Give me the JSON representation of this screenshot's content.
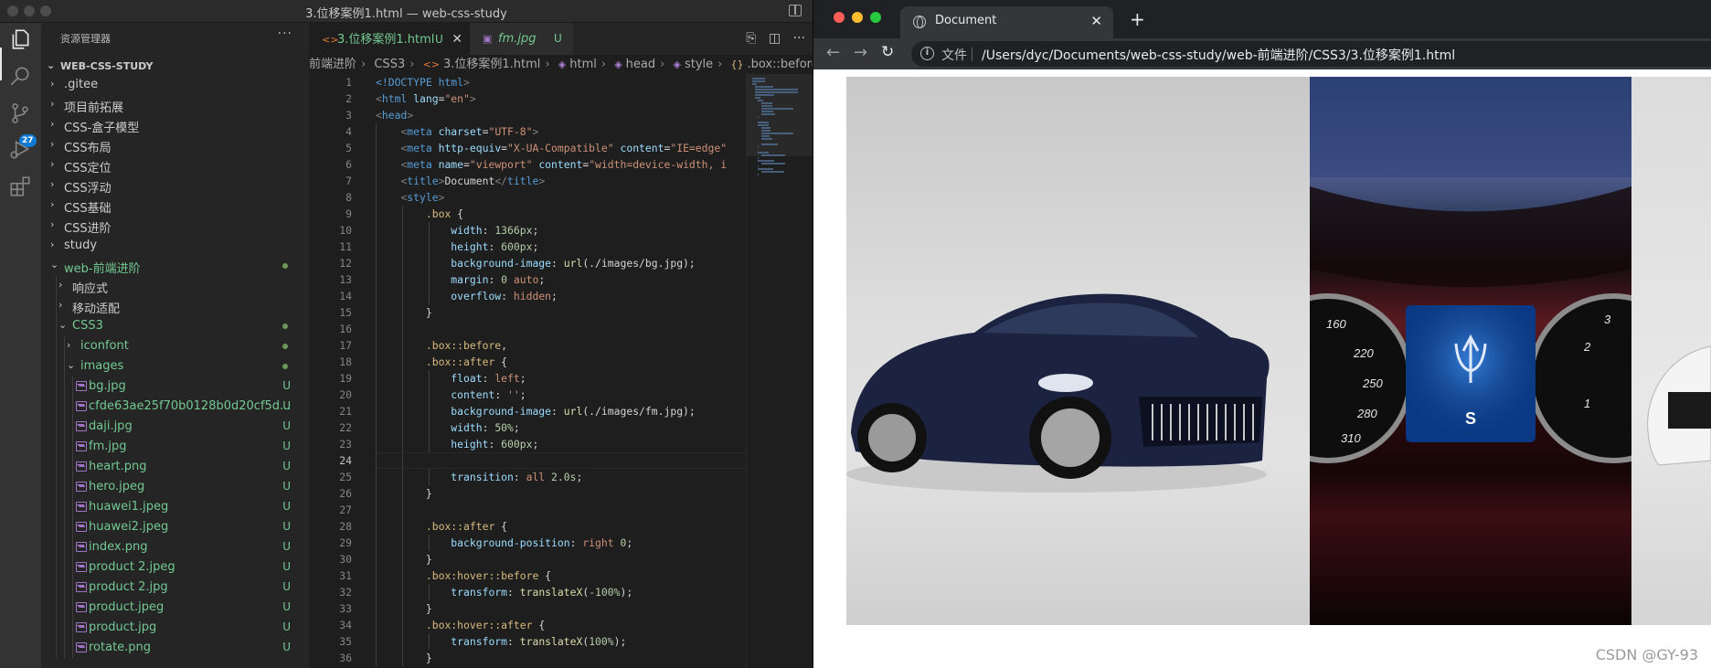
{
  "vscode": {
    "window_title": "3.位移案例1.html — web-css-study",
    "explorer_header": "资源管理器",
    "more_label": "···",
    "folder_name": "WEB-CSS-STUDY",
    "scm_badge": "27",
    "tree": [
      {
        "label": ".gitee",
        "depth": 0,
        "type": "folder",
        "open": false
      },
      {
        "label": "项目前拓展",
        "depth": 0,
        "type": "folder",
        "open": false
      },
      {
        "label": "CSS-盒子模型",
        "depth": 0,
        "type": "folder",
        "open": false
      },
      {
        "label": "CSS布局",
        "depth": 0,
        "type": "folder",
        "open": false
      },
      {
        "label": "CSS定位",
        "depth": 0,
        "type": "folder",
        "open": false
      },
      {
        "label": "CSS浮动",
        "depth": 0,
        "type": "folder",
        "open": false
      },
      {
        "label": "CSS基础",
        "depth": 0,
        "type": "folder",
        "open": false
      },
      {
        "label": "CSS进阶",
        "depth": 0,
        "type": "folder",
        "open": false
      },
      {
        "label": "study",
        "depth": 0,
        "type": "folder",
        "open": false
      },
      {
        "label": "web-前端进阶",
        "depth": 0,
        "type": "folder",
        "open": true,
        "green": true,
        "dot": true
      },
      {
        "label": "响应式",
        "depth": 1,
        "type": "folder",
        "open": false
      },
      {
        "label": "移动适配",
        "depth": 1,
        "type": "folder",
        "open": false
      },
      {
        "label": "CSS3",
        "depth": 1,
        "type": "folder",
        "open": true,
        "green": true,
        "dot": true
      },
      {
        "label": "iconfont",
        "depth": 2,
        "type": "folder",
        "open": false,
        "green": true,
        "dot": true
      },
      {
        "label": "images",
        "depth": 2,
        "type": "folder",
        "open": true,
        "green": true,
        "dot": true
      },
      {
        "label": "bg.jpg",
        "depth": 3,
        "type": "image",
        "green": true,
        "mark": "U"
      },
      {
        "label": "cfde63ae25f70b0128b0d20cf5d...",
        "depth": 3,
        "type": "image",
        "green": true,
        "mark": "U"
      },
      {
        "label": "daji.jpg",
        "depth": 3,
        "type": "image",
        "green": true,
        "mark": "U"
      },
      {
        "label": "fm.jpg",
        "depth": 3,
        "type": "image",
        "green": true,
        "mark": "U"
      },
      {
        "label": "heart.png",
        "depth": 3,
        "type": "image",
        "green": true,
        "mark": "U"
      },
      {
        "label": "hero.jpeg",
        "depth": 3,
        "type": "image",
        "green": true,
        "mark": "U"
      },
      {
        "label": "huawei1.jpeg",
        "depth": 3,
        "type": "image",
        "green": true,
        "mark": "U"
      },
      {
        "label": "huawei2.jpeg",
        "depth": 3,
        "type": "image",
        "green": true,
        "mark": "U"
      },
      {
        "label": "index.png",
        "depth": 3,
        "type": "image",
        "green": true,
        "mark": "U"
      },
      {
        "label": "product 2.jpeg",
        "depth": 3,
        "type": "image",
        "green": true,
        "mark": "U"
      },
      {
        "label": "product 2.jpg",
        "depth": 3,
        "type": "image",
        "green": true,
        "mark": "U"
      },
      {
        "label": "product.jpeg",
        "depth": 3,
        "type": "image",
        "green": true,
        "mark": "U"
      },
      {
        "label": "product.jpg",
        "depth": 3,
        "type": "image",
        "green": true,
        "mark": "U"
      },
      {
        "label": "rotate.png",
        "depth": 3,
        "type": "image",
        "green": true,
        "mark": "U"
      }
    ],
    "tabs": [
      {
        "name": "3.位移案例1.html",
        "mark": "U",
        "icon": "html-icon"
      },
      {
        "name": "fm.jpg",
        "mark": "U",
        "icon": "image-icon"
      }
    ],
    "breadcrumb": [
      "前端进阶",
      "CSS3",
      "3.位移案例1.html",
      "html",
      "head",
      "style",
      ".box::before"
    ],
    "current_line": 24,
    "code_lines": [
      [
        [
          "doc",
          "<!DOCTYPE "
        ],
        [
          "tag",
          "html"
        ],
        [
          "ang",
          ">"
        ]
      ],
      [
        [
          "ang",
          "<"
        ],
        [
          "tag",
          "html "
        ],
        [
          "attr",
          "lang"
        ],
        [
          "txt",
          "="
        ],
        [
          "str",
          "\"en\""
        ],
        [
          "ang",
          ">"
        ]
      ],
      [
        [
          "ang",
          "<"
        ],
        [
          "tag",
          "head"
        ],
        [
          "ang",
          ">"
        ]
      ],
      [
        [
          "txt",
          "    "
        ],
        [
          "ang",
          "<"
        ],
        [
          "tag",
          "meta "
        ],
        [
          "attr",
          "charset"
        ],
        [
          "txt",
          "="
        ],
        [
          "str",
          "\"UTF-8\""
        ],
        [
          "ang",
          ">"
        ]
      ],
      [
        [
          "txt",
          "    "
        ],
        [
          "ang",
          "<"
        ],
        [
          "tag",
          "meta "
        ],
        [
          "attr",
          "http-equiv"
        ],
        [
          "txt",
          "="
        ],
        [
          "str",
          "\"X-UA-Compatible\" "
        ],
        [
          "attr",
          "content"
        ],
        [
          "txt",
          "="
        ],
        [
          "str",
          "\"IE=edge\""
        ]
      ],
      [
        [
          "txt",
          "    "
        ],
        [
          "ang",
          "<"
        ],
        [
          "tag",
          "meta "
        ],
        [
          "attr",
          "name"
        ],
        [
          "txt",
          "="
        ],
        [
          "str",
          "\"viewport\" "
        ],
        [
          "attr",
          "content"
        ],
        [
          "txt",
          "="
        ],
        [
          "str",
          "\"width=device-width, i"
        ]
      ],
      [
        [
          "txt",
          "    "
        ],
        [
          "ang",
          "<"
        ],
        [
          "tag",
          "title"
        ],
        [
          "ang",
          ">"
        ],
        [
          "txt",
          "Document"
        ],
        [
          "ang",
          "</"
        ],
        [
          "tag",
          "title"
        ],
        [
          "ang",
          ">"
        ]
      ],
      [
        [
          "txt",
          "    "
        ],
        [
          "ang",
          "<"
        ],
        [
          "tag",
          "style"
        ],
        [
          "ang",
          ">"
        ]
      ],
      [
        [
          "txt",
          "        "
        ],
        [
          "sel",
          ".box"
        ],
        [
          "txt",
          " {"
        ]
      ],
      [
        [
          "txt",
          "            "
        ],
        [
          "prop",
          "width"
        ],
        [
          "txt",
          ": "
        ],
        [
          "num",
          "1366px"
        ],
        [
          "txt",
          ";"
        ]
      ],
      [
        [
          "txt",
          "            "
        ],
        [
          "prop",
          "height"
        ],
        [
          "txt",
          ": "
        ],
        [
          "num",
          "600px"
        ],
        [
          "txt",
          ";"
        ]
      ],
      [
        [
          "txt",
          "            "
        ],
        [
          "prop",
          "background-image"
        ],
        [
          "txt",
          ": "
        ],
        [
          "fn",
          "url"
        ],
        [
          "txt",
          "(./images/bg.jpg);"
        ]
      ],
      [
        [
          "txt",
          "            "
        ],
        [
          "prop",
          "margin"
        ],
        [
          "txt",
          ": "
        ],
        [
          "num",
          "0"
        ],
        [
          "str",
          " auto"
        ],
        [
          "txt",
          ";"
        ]
      ],
      [
        [
          "txt",
          "            "
        ],
        [
          "prop",
          "overflow"
        ],
        [
          "txt",
          ": "
        ],
        [
          "str",
          "hidden"
        ],
        [
          "txt",
          ";"
        ]
      ],
      [
        [
          "txt",
          "        }"
        ]
      ],
      [
        [
          "txt",
          ""
        ]
      ],
      [
        [
          "txt",
          "        "
        ],
        [
          "sel",
          ".box::before"
        ],
        [
          "txt",
          ","
        ]
      ],
      [
        [
          "txt",
          "        "
        ],
        [
          "sel",
          ".box::after"
        ],
        [
          "txt",
          " {"
        ]
      ],
      [
        [
          "txt",
          "            "
        ],
        [
          "prop",
          "float"
        ],
        [
          "txt",
          ": "
        ],
        [
          "str",
          "left"
        ],
        [
          "txt",
          ";"
        ]
      ],
      [
        [
          "txt",
          "            "
        ],
        [
          "prop",
          "content"
        ],
        [
          "txt",
          ": "
        ],
        [
          "str",
          "''"
        ],
        [
          "txt",
          ";"
        ]
      ],
      [
        [
          "txt",
          "            "
        ],
        [
          "prop",
          "background-image"
        ],
        [
          "txt",
          ": "
        ],
        [
          "fn",
          "url"
        ],
        [
          "txt",
          "(./images/fm.jpg);"
        ]
      ],
      [
        [
          "txt",
          "            "
        ],
        [
          "prop",
          "width"
        ],
        [
          "txt",
          ": "
        ],
        [
          "num",
          "50%"
        ],
        [
          "txt",
          ";"
        ]
      ],
      [
        [
          "txt",
          "            "
        ],
        [
          "prop",
          "height"
        ],
        [
          "txt",
          ": "
        ],
        [
          "num",
          "600px"
        ],
        [
          "txt",
          ";"
        ]
      ],
      [
        [
          "txt",
          ""
        ]
      ],
      [
        [
          "txt",
          "            "
        ],
        [
          "prop",
          "transition"
        ],
        [
          "txt",
          ": "
        ],
        [
          "str",
          "all "
        ],
        [
          "num",
          "2.0s"
        ],
        [
          "txt",
          ";"
        ]
      ],
      [
        [
          "txt",
          "        }"
        ]
      ],
      [
        [
          "txt",
          ""
        ]
      ],
      [
        [
          "txt",
          "        "
        ],
        [
          "sel",
          ".box::after"
        ],
        [
          "txt",
          " {"
        ]
      ],
      [
        [
          "txt",
          "            "
        ],
        [
          "prop",
          "background-position"
        ],
        [
          "txt",
          ": "
        ],
        [
          "str",
          "right "
        ],
        [
          "num",
          "0"
        ],
        [
          "txt",
          ";"
        ]
      ],
      [
        [
          "txt",
          "        }"
        ]
      ],
      [
        [
          "txt",
          "        "
        ],
        [
          "sel",
          ".box:hover::before"
        ],
        [
          "txt",
          " {"
        ]
      ],
      [
        [
          "txt",
          "            "
        ],
        [
          "prop",
          "transform"
        ],
        [
          "txt",
          ": "
        ],
        [
          "fn",
          "translateX"
        ],
        [
          "txt",
          "("
        ],
        [
          "num",
          "-100%"
        ],
        [
          "txt",
          ");"
        ]
      ],
      [
        [
          "txt",
          "        }"
        ]
      ],
      [
        [
          "txt",
          "        "
        ],
        [
          "sel",
          ".box:hover::after"
        ],
        [
          "txt",
          " {"
        ]
      ],
      [
        [
          "txt",
          "            "
        ],
        [
          "prop",
          "transform"
        ],
        [
          "txt",
          ": "
        ],
        [
          "fn",
          "translateX"
        ],
        [
          "txt",
          "("
        ],
        [
          "num",
          "100%"
        ],
        [
          "txt",
          ");"
        ]
      ],
      [
        [
          "txt",
          "        }"
        ]
      ]
    ]
  },
  "browser": {
    "tab_title": "Document",
    "address_label": "文件",
    "url": "/Users/dyc/Documents/web-css-study/web-前端进阶/CSS3/3.位移案例1.html",
    "watermark": "CSDN @GY-93",
    "colors": {
      "close_red": "#ff5f57",
      "minimize_yellow": "#febc2e",
      "maximize_green": "#28c840"
    }
  }
}
